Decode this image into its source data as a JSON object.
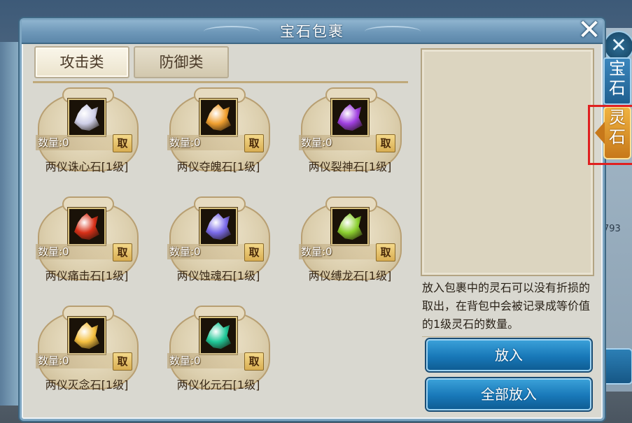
{
  "window": {
    "title": "宝石包裹",
    "close_label": "✕"
  },
  "tabs": [
    {
      "label": "攻击类",
      "active": true
    },
    {
      "label": "防御类",
      "active": false
    }
  ],
  "gems": [
    {
      "name": "两仪诛心石[1级]",
      "count_label": "数量:0",
      "take_label": "取",
      "color": "#cfcfe8"
    },
    {
      "name": "两仪夺魄石[1级]",
      "count_label": "数量:0",
      "take_label": "取",
      "color": "#f0a030"
    },
    {
      "name": "两仪裂神石[1级]",
      "count_label": "数量:0",
      "take_label": "取",
      "color": "#a040e0"
    },
    {
      "name": "两仪痛击石[1级]",
      "count_label": "数量:0",
      "take_label": "取",
      "color": "#d83018"
    },
    {
      "name": "两仪蚀魂石[1级]",
      "count_label": "数量:0",
      "take_label": "取",
      "color": "#7a6ae8"
    },
    {
      "name": "两仪缚龙石[1级]",
      "count_label": "数量:0",
      "take_label": "取",
      "color": "#8cd030"
    },
    {
      "name": "两仪灭念石[1级]",
      "count_label": "数量:0",
      "take_label": "取",
      "color": "#f5c040"
    },
    {
      "name": "两仪化元石[1级]",
      "count_label": "数量:0",
      "take_label": "取",
      "color": "#20c898"
    }
  ],
  "info": {
    "text": "放入包裹中的灵石可以没有折损的取出，在背包中会被记录成等价值的1级灵石的数量。"
  },
  "buttons": {
    "put_in": "放入",
    "put_all": "全部放入"
  },
  "side_tabs": {
    "gem": "宝石",
    "spirit": "灵石"
  },
  "background": {
    "number_fragment": "793"
  }
}
